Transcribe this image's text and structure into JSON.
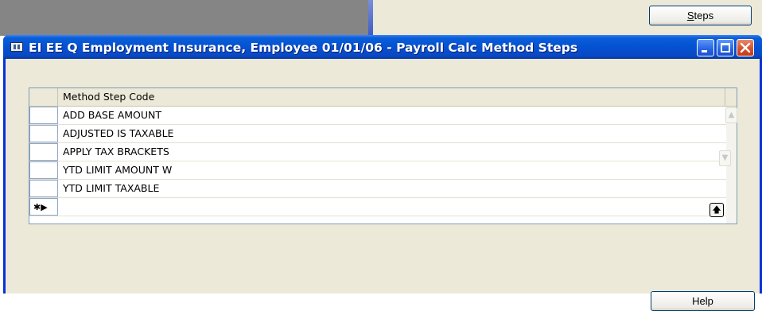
{
  "background": {
    "steps_button": {
      "accel": "S",
      "rest": "teps"
    }
  },
  "window": {
    "title": "EI EE Q Employment Insurance, Employee 01/01/06 - Payroll Calc Method Steps",
    "icon": "form-icon",
    "controls": [
      "minimize-icon",
      "maximize-icon",
      "close-icon"
    ]
  },
  "grid": {
    "column_header": "Method Step Code",
    "rows": [
      "ADD BASE AMOUNT",
      "ADJUSTED IS TAXABLE",
      "APPLY TAX BRACKETS",
      "YTD LIMIT AMOUNT W",
      "YTD LIMIT TAXABLE"
    ],
    "new_row_marker": "✱▶",
    "goto_icon": "up-arrow-icon"
  },
  "footer": {
    "help_label": "Help"
  },
  "colors": {
    "titlebar": "#0450d1",
    "window_bg": "#ece9d8",
    "close_button": "#d8502d"
  }
}
